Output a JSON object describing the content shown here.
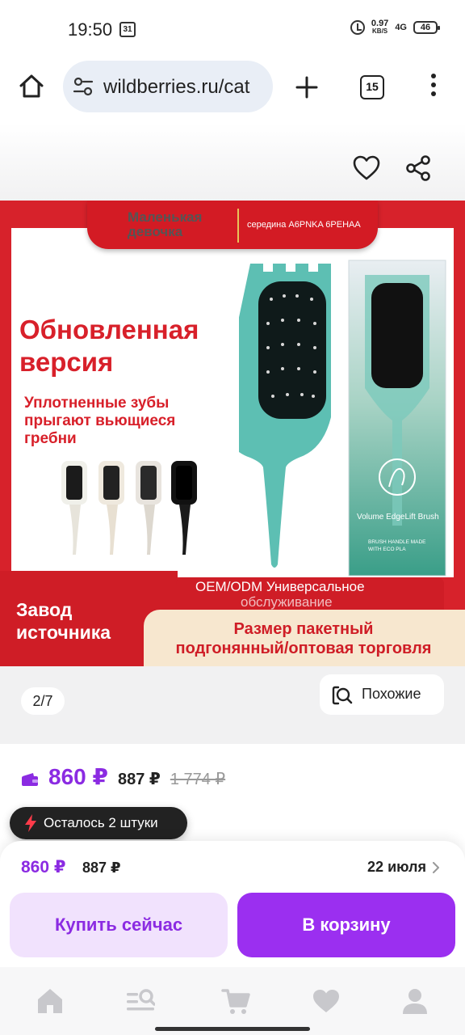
{
  "status_bar": {
    "time": "19:50",
    "calendar_day": "31",
    "net_speed_value": "0.97",
    "net_speed_unit": "KB/S",
    "signal": "4G",
    "battery": "46"
  },
  "browser": {
    "url": "wildberries.ru/cat",
    "tab_count": "15"
  },
  "product_image": {
    "brand": "Маленькая девочка",
    "brand_sub": "середина А6PNKA 6PEHAA",
    "headline_line1": "Обновленная",
    "headline_line2": "версия",
    "subline1": "Уплотненные зубы",
    "subline2": "прыгают вьющиеся",
    "subline3": "гребни",
    "box_title": "Volume EdgeLift Brush",
    "box_note1": "BRUSH HANDLE MADE",
    "box_note2": "WITH ECO PLA",
    "bottom_left1": "Завод",
    "bottom_left2": "источника",
    "oem1": "OEM/ODM Универсальное",
    "oem2": "обслуживание",
    "cream1": "Размер пакетный",
    "cream2": "подгонянный/оптовая торговля"
  },
  "gallery": {
    "counter": "2/7",
    "similar_label": "Похожие"
  },
  "price": {
    "wallet_price": "860 ₽",
    "price": "887 ₽",
    "old_price": "1 774 ₽"
  },
  "stock": {
    "text": "Осталось 2 штуки"
  },
  "bottom_sheet": {
    "price": "860 ₽",
    "price2": "887 ₽",
    "delivery_date": "22 июля",
    "buy_now": "Купить сейчас",
    "add_to_cart": "В корзину"
  },
  "colors": {
    "accent": "#9b2ff0",
    "accent_light": "#f1e2fd",
    "price": "#8b2be2",
    "banner_red": "#d7222b",
    "brush_teal": "#5dbfb3"
  },
  "nav": {
    "items": [
      "home-icon",
      "catalog-search-icon",
      "cart-icon",
      "favorites-icon",
      "profile-icon"
    ]
  }
}
